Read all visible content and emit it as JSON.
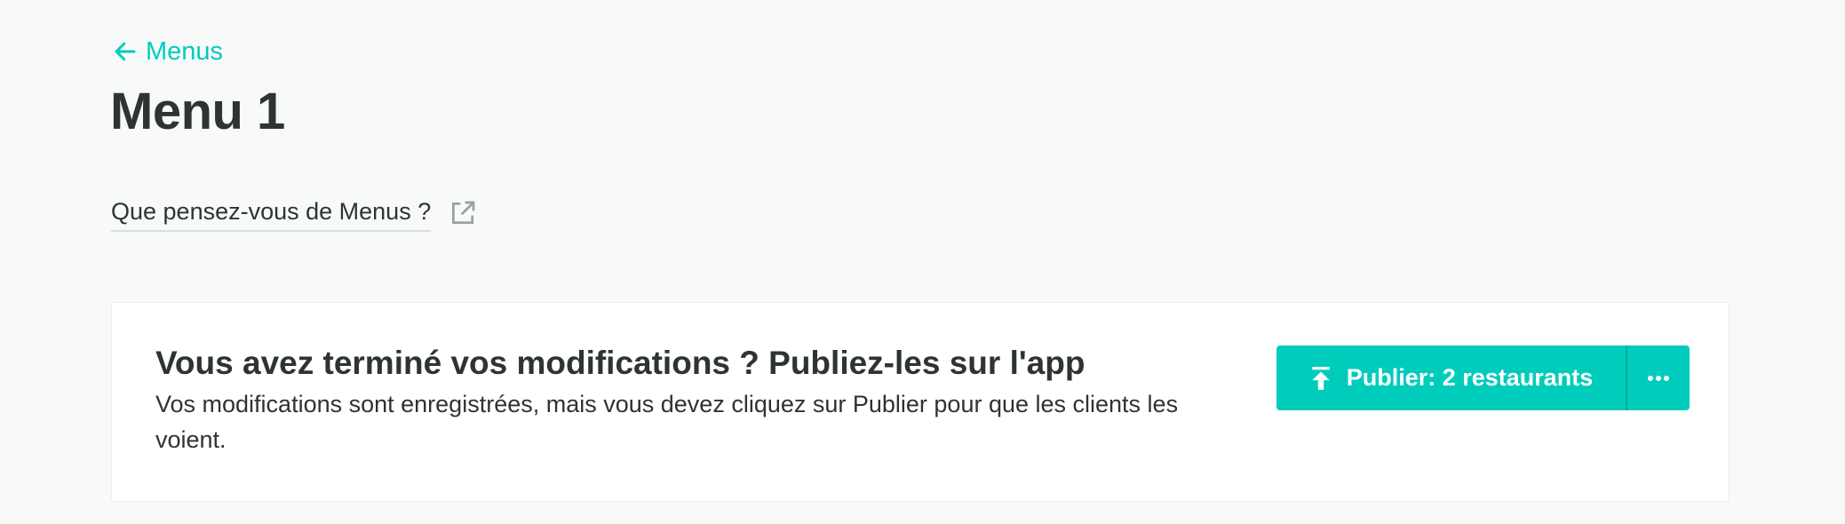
{
  "header": {
    "back_link_label": "Menus",
    "page_title": "Menu 1"
  },
  "feedback": {
    "label": "Que pensez-vous de Menus ?"
  },
  "publish_card": {
    "title": "Vous avez terminé vos modifications ? Publiez-les sur l'app",
    "description": "Vos modifications sont enregistrées, mais vous devez cliquez sur Publier pour que les clients les voient.",
    "publish_button_label": "Publier: 2 restaurants"
  },
  "colors": {
    "accent": "#00ccbc",
    "text": "#2e3333",
    "background": "#f8f9f9",
    "card": "#ffffff"
  },
  "icons": {
    "back": "arrow-left-icon",
    "external": "external-link-icon",
    "publish": "upload-icon",
    "more": "more-horizontal-icon"
  }
}
